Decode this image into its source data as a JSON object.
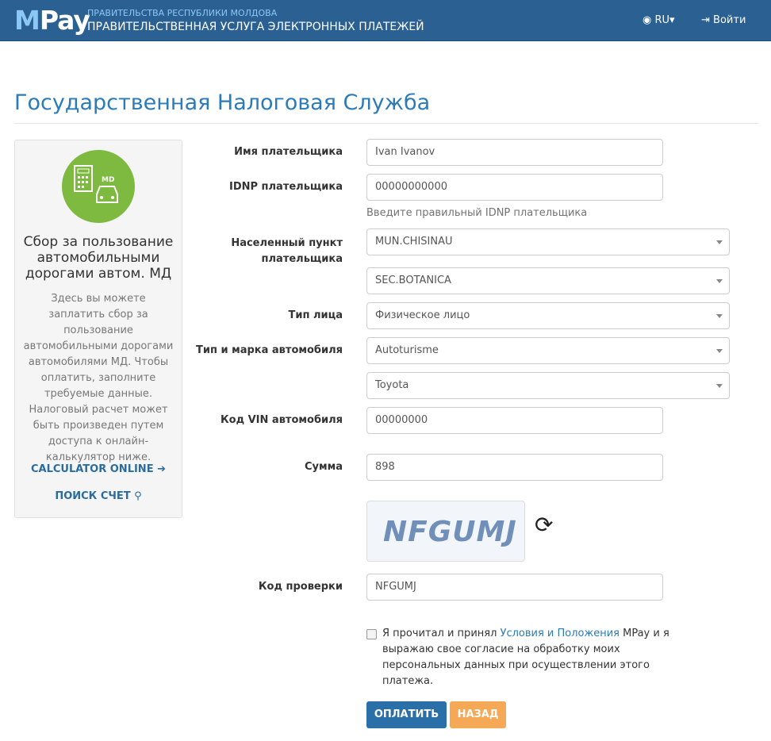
{
  "header": {
    "logo_m": "M",
    "logo_pay": "Pay",
    "subtitle_top": "ПРАВИТЕЛЬСТВА РЕСПУБЛИКИ МОЛДОВА",
    "subtitle_main": "ПРАВИТЕЛЬСТВЕННАЯ УСЛУГА ЭЛЕКТРОННЫХ ПЛАТЕЖЕЙ",
    "language": "RU",
    "login": "Войти"
  },
  "page_title": "Государственная Налоговая Служба",
  "sidebar": {
    "icon_badge": "MD",
    "title": "Сбор за пользование автомобильными дорогами автом. МД",
    "description": "Здесь вы можете заплатить сбор за пользование автомобильными дорогами автомобилями МД. Чтобы оплатить, заполните требуемые данные. Налоговый расчет может быть произведен путем доступа к онлайн-калькулятор ниже.",
    "calculator_link": "CALCULATOR ONLINE",
    "search_link": "ПОИСК СЧЕТ"
  },
  "form": {
    "payer_name": {
      "label": "Имя плательщика",
      "value": "Ivan Ivanov"
    },
    "idnp": {
      "label": "IDNP плательщика",
      "value": "00000000000",
      "help": "Введите правильный IDNP плательщика"
    },
    "locality": {
      "label": "Населенный пункт плательщика",
      "value": "MUN.CHISINAU",
      "sector": "SEC.BOTANICA"
    },
    "person_type": {
      "label": "Тип лица",
      "value": "Физическое лицо"
    },
    "vehicle": {
      "label": "Тип и марка автомобиля",
      "type": "Autoturisme",
      "brand": "Toyota"
    },
    "vin": {
      "label": "Код VIN автомобиля",
      "value": "00000000"
    },
    "amount": {
      "label": "Сумма",
      "value": "898"
    },
    "captcha": {
      "image_text": "NFGUMJ",
      "label": "Код проверки",
      "value": "NFGUMJ"
    },
    "terms": {
      "before": "Я прочитал и принял ",
      "link": "Условия и Положения",
      "after": " MPay и я выражаю свое согласие на обработку моих персональных данных при осуществлении этого платежа.",
      "checked": false
    },
    "pay_button": "ОПЛАТИТЬ",
    "back_button": "НАЗАД"
  },
  "colors": {
    "header": "#2b6093",
    "accent": "#2b7bb9",
    "icon_green": "#7dba3f",
    "pay": "#2a6fa8",
    "back": "#f5a855"
  }
}
